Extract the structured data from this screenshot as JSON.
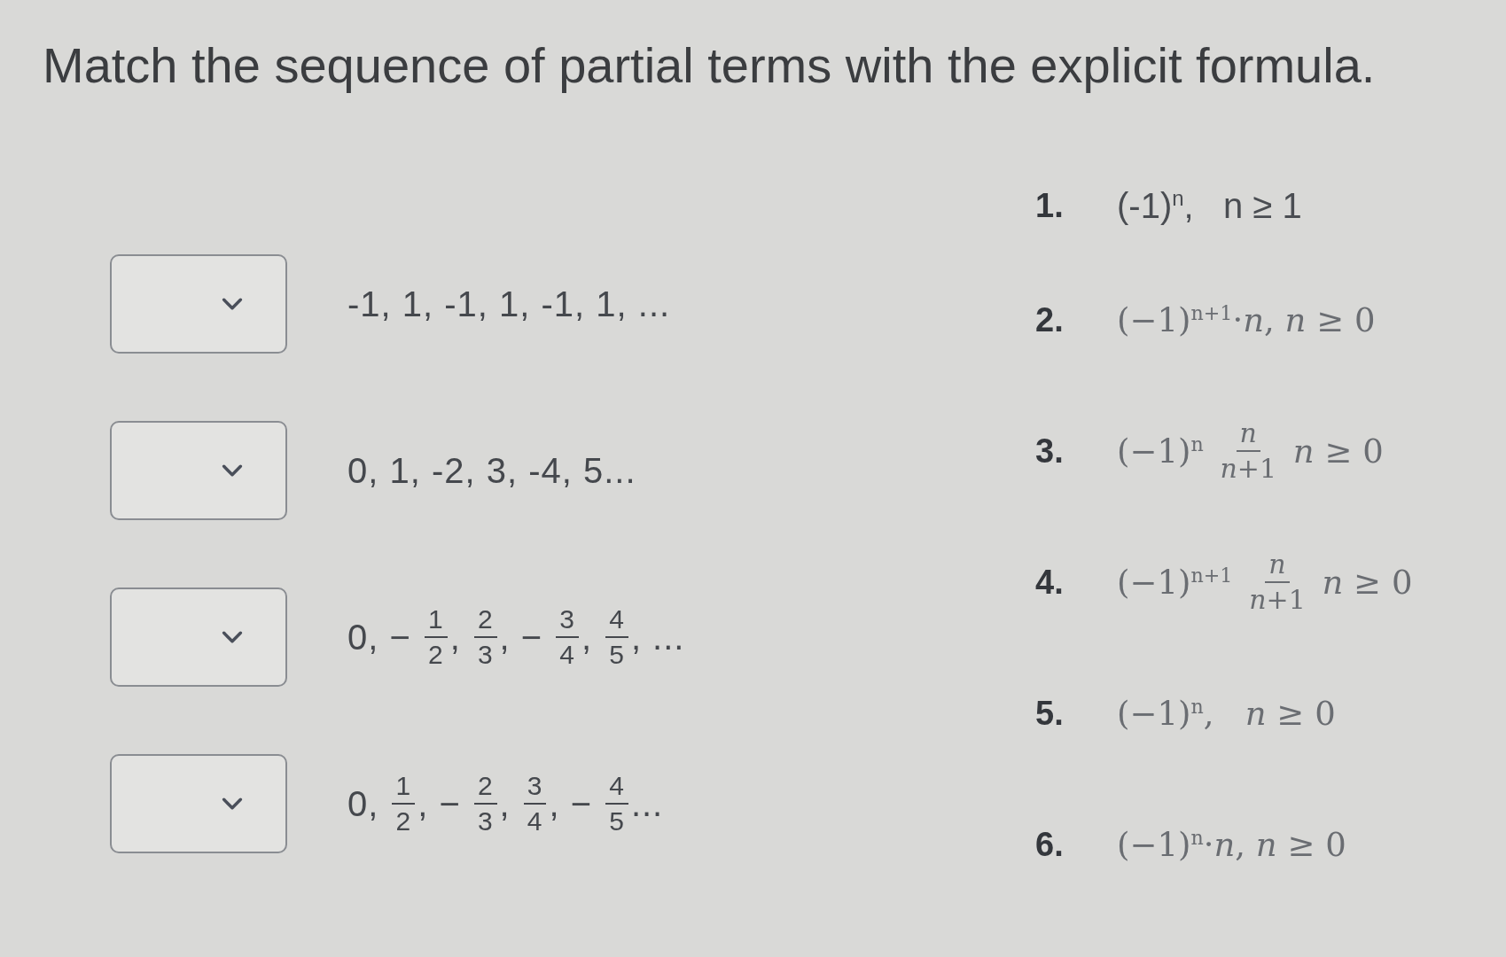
{
  "title": "Match the sequence of partial terms with the explicit formula.",
  "sequences": [
    {
      "parts": [
        {
          "kind": "text",
          "text": "-1, 1, -1, 1, -1, 1, ..."
        }
      ]
    },
    {
      "parts": [
        {
          "kind": "text",
          "text": "0, 1, -2, 3, -4, 5..."
        }
      ]
    },
    {
      "parts": [
        {
          "kind": "text",
          "text": "0, − "
        },
        {
          "kind": "fraction",
          "numerator": "1",
          "denominator": "2"
        },
        {
          "kind": "text",
          "text": ", "
        },
        {
          "kind": "fraction",
          "numerator": "2",
          "denominator": "3"
        },
        {
          "kind": "text",
          "text": ", − "
        },
        {
          "kind": "fraction",
          "numerator": "3",
          "denominator": "4"
        },
        {
          "kind": "text",
          "text": ", "
        },
        {
          "kind": "fraction",
          "numerator": "4",
          "denominator": "5"
        },
        {
          "kind": "text",
          "text": ", ..."
        }
      ]
    },
    {
      "parts": [
        {
          "kind": "text",
          "text": "0, "
        },
        {
          "kind": "fraction",
          "numerator": "1",
          "denominator": "2"
        },
        {
          "kind": "text",
          "text": ", − "
        },
        {
          "kind": "fraction",
          "numerator": "2",
          "denominator": "3"
        },
        {
          "kind": "text",
          "text": ", "
        },
        {
          "kind": "fraction",
          "numerator": "3",
          "denominator": "4"
        },
        {
          "kind": "text",
          "text": ", − "
        },
        {
          "kind": "fraction",
          "numerator": "4",
          "denominator": "5"
        },
        {
          "kind": "text",
          "text": "..."
        }
      ]
    }
  ],
  "formulas": [
    {
      "number": "1.",
      "kind": "plain",
      "parts": [
        {
          "kind": "text",
          "text": "(-1)$^{n}$,   n ≥ 1"
        }
      ]
    },
    {
      "number": "2.",
      "kind": "math",
      "parts": [
        {
          "kind": "text",
          "text": "(−1)$^{n+1}$·*n*, *n* ≥ 0"
        }
      ]
    },
    {
      "number": "3.",
      "kind": "math",
      "parts": [
        {
          "kind": "text",
          "text": "(−1)$^{n}$ "
        },
        {
          "kind": "fraction",
          "numerator": "*n*",
          "denominator": "*n*+1"
        },
        {
          "kind": "text",
          "text": " *n* ≥ 0"
        }
      ]
    },
    {
      "number": "4.",
      "kind": "math",
      "parts": [
        {
          "kind": "text",
          "text": "(−1)$^{n+1}$ "
        },
        {
          "kind": "fraction",
          "numerator": "*n*",
          "denominator": "*n*+1"
        },
        {
          "kind": "text",
          "text": " *n* ≥ 0"
        }
      ]
    },
    {
      "number": "5.",
      "kind": "math",
      "parts": [
        {
          "kind": "text",
          "text": "(−1)$^{n}$,   *n* ≥ 0"
        }
      ]
    },
    {
      "number": "6.",
      "kind": "math",
      "parts": [
        {
          "kind": "text",
          "text": "(−1)$^{n}$·*n*, *n* ≥ 0"
        }
      ]
    }
  ]
}
